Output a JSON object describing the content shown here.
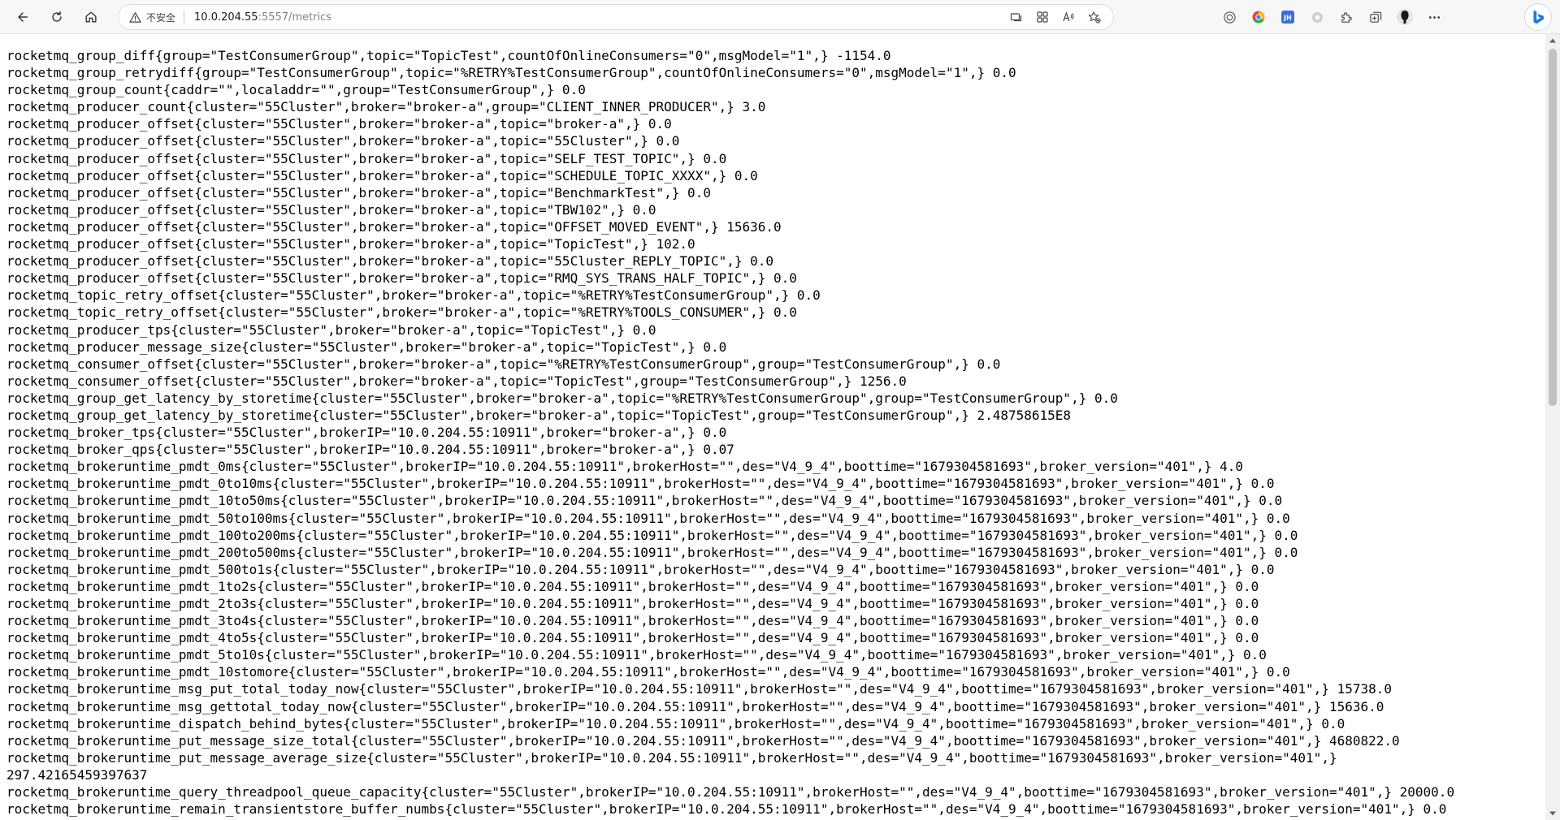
{
  "browser": {
    "security_label": "不安全",
    "url_host": "10.0.204.55",
    "url_rest": ":5557/metrics",
    "icons": {
      "back": "back-arrow-icon",
      "refresh": "refresh-icon",
      "home": "home-icon",
      "warning": "warning-triangle-icon",
      "tab_actions": "tab-actions-icon",
      "apps": "apps-icon",
      "read_aloud": "read-aloud-icon",
      "favorites": "add-favorite-icon",
      "extensions": "extensions-icon",
      "collections": "collections-icon",
      "profile": "profile-avatar-icon",
      "more": "more-icon",
      "bing": "bing-chat-icon"
    },
    "accent_color": "#0078d4"
  },
  "metrics_lines": [
    "rocketmq_group_diff{group=\"TestConsumerGroup\",topic=\"TopicTest\",countOfOnlineConsumers=\"0\",msgModel=\"1\",} -1154.0",
    "rocketmq_group_retrydiff{group=\"TestConsumerGroup\",topic=\"%RETRY%TestConsumerGroup\",countOfOnlineConsumers=\"0\",msgModel=\"1\",} 0.0",
    "rocketmq_group_count{caddr=\"\",localaddr=\"\",group=\"TestConsumerGroup\",} 0.0",
    "rocketmq_producer_count{cluster=\"55Cluster\",broker=\"broker-a\",group=\"CLIENT_INNER_PRODUCER\",} 3.0",
    "rocketmq_producer_offset{cluster=\"55Cluster\",broker=\"broker-a\",topic=\"broker-a\",} 0.0",
    "rocketmq_producer_offset{cluster=\"55Cluster\",broker=\"broker-a\",topic=\"55Cluster\",} 0.0",
    "rocketmq_producer_offset{cluster=\"55Cluster\",broker=\"broker-a\",topic=\"SELF_TEST_TOPIC\",} 0.0",
    "rocketmq_producer_offset{cluster=\"55Cluster\",broker=\"broker-a\",topic=\"SCHEDULE_TOPIC_XXXX\",} 0.0",
    "rocketmq_producer_offset{cluster=\"55Cluster\",broker=\"broker-a\",topic=\"BenchmarkTest\",} 0.0",
    "rocketmq_producer_offset{cluster=\"55Cluster\",broker=\"broker-a\",topic=\"TBW102\",} 0.0",
    "rocketmq_producer_offset{cluster=\"55Cluster\",broker=\"broker-a\",topic=\"OFFSET_MOVED_EVENT\",} 15636.0",
    "rocketmq_producer_offset{cluster=\"55Cluster\",broker=\"broker-a\",topic=\"TopicTest\",} 102.0",
    "rocketmq_producer_offset{cluster=\"55Cluster\",broker=\"broker-a\",topic=\"55Cluster_REPLY_TOPIC\",} 0.0",
    "rocketmq_producer_offset{cluster=\"55Cluster\",broker=\"broker-a\",topic=\"RMQ_SYS_TRANS_HALF_TOPIC\",} 0.0",
    "rocketmq_topic_retry_offset{cluster=\"55Cluster\",broker=\"broker-a\",topic=\"%RETRY%TestConsumerGroup\",} 0.0",
    "rocketmq_topic_retry_offset{cluster=\"55Cluster\",broker=\"broker-a\",topic=\"%RETRY%TOOLS_CONSUMER\",} 0.0",
    "rocketmq_producer_tps{cluster=\"55Cluster\",broker=\"broker-a\",topic=\"TopicTest\",} 0.0",
    "rocketmq_producer_message_size{cluster=\"55Cluster\",broker=\"broker-a\",topic=\"TopicTest\",} 0.0",
    "rocketmq_consumer_offset{cluster=\"55Cluster\",broker=\"broker-a\",topic=\"%RETRY%TestConsumerGroup\",group=\"TestConsumerGroup\",} 0.0",
    "rocketmq_consumer_offset{cluster=\"55Cluster\",broker=\"broker-a\",topic=\"TopicTest\",group=\"TestConsumerGroup\",} 1256.0",
    "rocketmq_group_get_latency_by_storetime{cluster=\"55Cluster\",broker=\"broker-a\",topic=\"%RETRY%TestConsumerGroup\",group=\"TestConsumerGroup\",} 0.0",
    "rocketmq_group_get_latency_by_storetime{cluster=\"55Cluster\",broker=\"broker-a\",topic=\"TopicTest\",group=\"TestConsumerGroup\",} 2.48758615E8",
    "rocketmq_broker_tps{cluster=\"55Cluster\",brokerIP=\"10.0.204.55:10911\",broker=\"broker-a\",} 0.0",
    "rocketmq_broker_qps{cluster=\"55Cluster\",brokerIP=\"10.0.204.55:10911\",broker=\"broker-a\",} 0.07",
    "rocketmq_brokeruntime_pmdt_0ms{cluster=\"55Cluster\",brokerIP=\"10.0.204.55:10911\",brokerHost=\"\",des=\"V4_9_4\",boottime=\"1679304581693\",broker_version=\"401\",} 4.0",
    "rocketmq_brokeruntime_pmdt_0to10ms{cluster=\"55Cluster\",brokerIP=\"10.0.204.55:10911\",brokerHost=\"\",des=\"V4_9_4\",boottime=\"1679304581693\",broker_version=\"401\",} 0.0",
    "rocketmq_brokeruntime_pmdt_10to50ms{cluster=\"55Cluster\",brokerIP=\"10.0.204.55:10911\",brokerHost=\"\",des=\"V4_9_4\",boottime=\"1679304581693\",broker_version=\"401\",} 0.0",
    "rocketmq_brokeruntime_pmdt_50to100ms{cluster=\"55Cluster\",brokerIP=\"10.0.204.55:10911\",brokerHost=\"\",des=\"V4_9_4\",boottime=\"1679304581693\",broker_version=\"401\",} 0.0",
    "rocketmq_brokeruntime_pmdt_100to200ms{cluster=\"55Cluster\",brokerIP=\"10.0.204.55:10911\",brokerHost=\"\",des=\"V4_9_4\",boottime=\"1679304581693\",broker_version=\"401\",} 0.0",
    "rocketmq_brokeruntime_pmdt_200to500ms{cluster=\"55Cluster\",brokerIP=\"10.0.204.55:10911\",brokerHost=\"\",des=\"V4_9_4\",boottime=\"1679304581693\",broker_version=\"401\",} 0.0",
    "rocketmq_brokeruntime_pmdt_500to1s{cluster=\"55Cluster\",brokerIP=\"10.0.204.55:10911\",brokerHost=\"\",des=\"V4_9_4\",boottime=\"1679304581693\",broker_version=\"401\",} 0.0",
    "rocketmq_brokeruntime_pmdt_1to2s{cluster=\"55Cluster\",brokerIP=\"10.0.204.55:10911\",brokerHost=\"\",des=\"V4_9_4\",boottime=\"1679304581693\",broker_version=\"401\",} 0.0",
    "rocketmq_brokeruntime_pmdt_2to3s{cluster=\"55Cluster\",brokerIP=\"10.0.204.55:10911\",brokerHost=\"\",des=\"V4_9_4\",boottime=\"1679304581693\",broker_version=\"401\",} 0.0",
    "rocketmq_brokeruntime_pmdt_3to4s{cluster=\"55Cluster\",brokerIP=\"10.0.204.55:10911\",brokerHost=\"\",des=\"V4_9_4\",boottime=\"1679304581693\",broker_version=\"401\",} 0.0",
    "rocketmq_brokeruntime_pmdt_4to5s{cluster=\"55Cluster\",brokerIP=\"10.0.204.55:10911\",brokerHost=\"\",des=\"V4_9_4\",boottime=\"1679304581693\",broker_version=\"401\",} 0.0",
    "rocketmq_brokeruntime_pmdt_5to10s{cluster=\"55Cluster\",brokerIP=\"10.0.204.55:10911\",brokerHost=\"\",des=\"V4_9_4\",boottime=\"1679304581693\",broker_version=\"401\",} 0.0",
    "rocketmq_brokeruntime_pmdt_10stomore{cluster=\"55Cluster\",brokerIP=\"10.0.204.55:10911\",brokerHost=\"\",des=\"V4_9_4\",boottime=\"1679304581693\",broker_version=\"401\",} 0.0",
    "rocketmq_brokeruntime_msg_put_total_today_now{cluster=\"55Cluster\",brokerIP=\"10.0.204.55:10911\",brokerHost=\"\",des=\"V4_9_4\",boottime=\"1679304581693\",broker_version=\"401\",} 15738.0",
    "rocketmq_brokeruntime_msg_gettotal_today_now{cluster=\"55Cluster\",brokerIP=\"10.0.204.55:10911\",brokerHost=\"\",des=\"V4_9_4\",boottime=\"1679304581693\",broker_version=\"401\",} 15636.0",
    "rocketmq_brokeruntime_dispatch_behind_bytes{cluster=\"55Cluster\",brokerIP=\"10.0.204.55:10911\",brokerHost=\"\",des=\"V4_9_4\",boottime=\"1679304581693\",broker_version=\"401\",} 0.0",
    "rocketmq_brokeruntime_put_message_size_total{cluster=\"55Cluster\",brokerIP=\"10.0.204.55:10911\",brokerHost=\"\",des=\"V4_9_4\",boottime=\"1679304581693\",broker_version=\"401\",} 4680822.0",
    "rocketmq_brokeruntime_put_message_average_size{cluster=\"55Cluster\",brokerIP=\"10.0.204.55:10911\",brokerHost=\"\",des=\"V4_9_4\",boottime=\"1679304581693\",broker_version=\"401\",}",
    "297.42165459397637",
    "rocketmq_brokeruntime_query_threadpool_queue_capacity{cluster=\"55Cluster\",brokerIP=\"10.0.204.55:10911\",brokerHost=\"\",des=\"V4_9_4\",boottime=\"1679304581693\",broker_version=\"401\",} 20000.0",
    "rocketmq_brokeruntime_remain_transientstore_buffer_numbs{cluster=\"55Cluster\",brokerIP=\"10.0.204.55:10911\",brokerHost=\"\",des=\"V4_9_4\",boottime=\"1679304581693\",broker_version=\"401\",} 0.0"
  ]
}
